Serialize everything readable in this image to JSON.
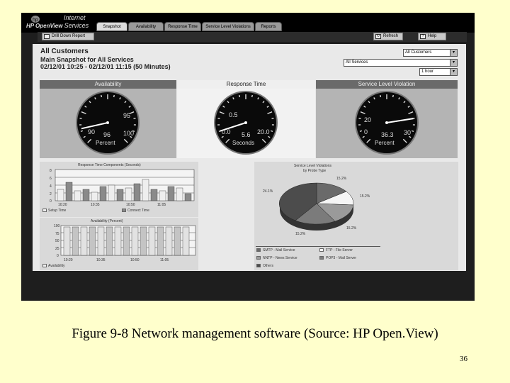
{
  "app": {
    "brand_line1": "Internet",
    "brand_line2a": "HP OpenView",
    "brand_line2b": "Services"
  },
  "tabs": [
    "Snapshot",
    "Availability",
    "Response Time",
    "Service Level Violations",
    "Reports"
  ],
  "toolbar": {
    "drill_down": "Drill Down Report",
    "refresh": "Refresh",
    "help": "Help"
  },
  "header": {
    "title": "All Customers",
    "subtitle": "Main Snapshot for All Services",
    "range": "02/12/01 10:25 - 02/12/01 11:15 (50 Minutes)"
  },
  "filters": {
    "customer": "All Customers",
    "service": "All Services",
    "interval": "1 hour"
  },
  "gauges": [
    {
      "title": "Availability",
      "ticks": [
        "90",
        "95",
        "100"
      ],
      "reading": "96",
      "unit": "Percent",
      "value_fraction": 0.12
    },
    {
      "title": "Response Time",
      "ticks": [
        "0.0",
        "0.5",
        "20.0"
      ],
      "reading": "5.6",
      "unit": "Seconds",
      "value_fraction": 0.1
    },
    {
      "title": "Service Level Violation",
      "ticks": [
        "0",
        "20",
        "30"
      ],
      "reading": "36.3",
      "unit": "Percent",
      "value_fraction": 0.8
    }
  ],
  "bar_chart_1": {
    "title": "Response Time Components (Seconds)",
    "y_ticks": [
      "8",
      "6",
      "4",
      "2",
      "0"
    ],
    "x_ticks": [
      "10:20",
      "10:35",
      "10:50",
      "11:05"
    ],
    "legend": [
      "Setup Time",
      "Connect Time"
    ]
  },
  "bar_chart_2": {
    "title": "Availability (Percent)",
    "y_ticks": [
      "100",
      "75",
      "50",
      "25",
      "0"
    ],
    "x_ticks": [
      "10:20",
      "10:35",
      "10:50",
      "11:05"
    ],
    "legend": [
      "Availability"
    ]
  },
  "pie_chart": {
    "title_line1": "Service Level Violations",
    "title_line2": "by Probe Type",
    "labels": [
      "15.2%",
      "15.2%",
      "24.1%",
      "15.2%",
      "15.2%"
    ],
    "legend": [
      "SMTP - Mail Service",
      "FTP - File Server",
      "NNTP - News Service",
      "POP3 - Mail Server",
      "Others"
    ]
  },
  "caption": "Figure 9-8 Network management software (Source: HP Open.View)",
  "page_number": "36",
  "colors": {
    "background": "#ffffcc",
    "frame": "#1e1e1e",
    "panel": "#e9e9e9"
  }
}
